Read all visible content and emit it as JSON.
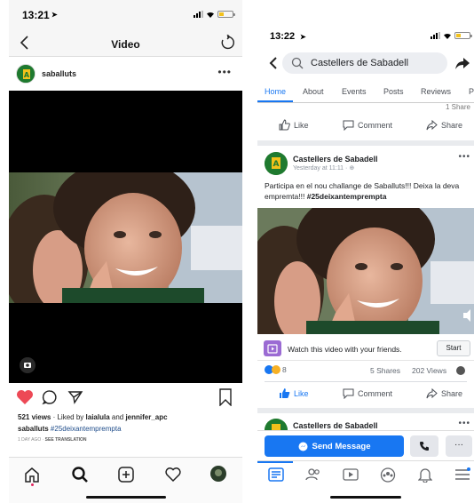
{
  "instagram": {
    "status": {
      "time": "13:21"
    },
    "nav": {
      "title": "Video"
    },
    "post": {
      "username": "saballuts",
      "stats_views": "521 views",
      "stats_liked_prefix": " · Liked by ",
      "liker1": "laialula",
      "liked_and": " and ",
      "liker2": "jennifer_apc",
      "caption_user": "saballuts",
      "caption_tag": "#25deixantemprempta",
      "time_ago": "1 DAY AGO",
      "meta_sep": " · ",
      "see_translation": "SEE TRANSLATION"
    }
  },
  "facebook": {
    "status": {
      "time": "13:22"
    },
    "search": {
      "text": "Castellers de Sabadell"
    },
    "tabs": [
      "Home",
      "About",
      "Events",
      "Posts",
      "Reviews",
      "P"
    ],
    "prev_card": {
      "peek_right": "1 Share"
    },
    "actions": {
      "like": "Like",
      "comment": "Comment",
      "share": "Share"
    },
    "post": {
      "page_name": "Castellers de Sabadell",
      "timestamp": "Yesterday at 11:11 · ",
      "text": "Participa en el nou challange de Saballuts!!! Deixa la deva empremta!!! ",
      "hashtag": "#25deixantemprempta",
      "watch_text": "Watch this video with your friends.",
      "start_button": "Start",
      "reactions_count": "8",
      "shares": "5 Shares",
      "views": "202 Views"
    },
    "next_card": {
      "page_name": "Castellers de Sabadell"
    },
    "bottom": {
      "send_message": "Send Message",
      "more": "···"
    },
    "colors": {
      "brand": "#1877f2",
      "like_red": "#ed4956"
    }
  }
}
